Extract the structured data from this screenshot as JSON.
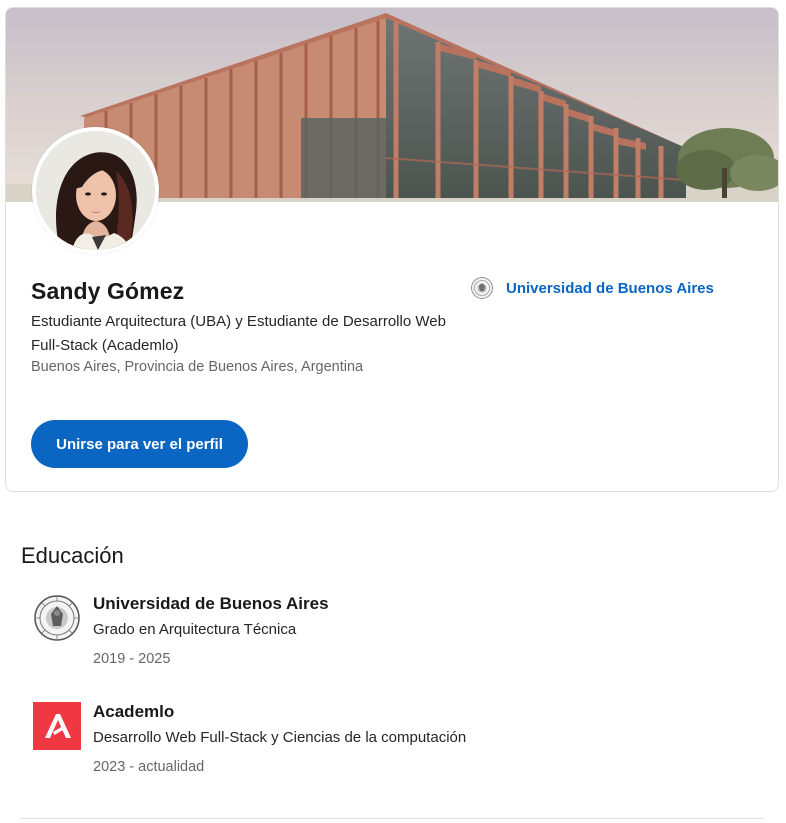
{
  "profile": {
    "name": "Sandy Gómez",
    "headline": "Estudiante Arquitectura (UBA) y Estudiante de Desarrollo Web Full-Stack (Academlo)",
    "location": "Buenos Aires, Provincia de Buenos Aires, Argentina",
    "current_school": "Universidad de Buenos Aires",
    "join_button_label": "Unirse para ver el perfil"
  },
  "education": {
    "title": "Educación",
    "items": [
      {
        "school": "Universidad de Buenos Aires",
        "degree": "Grado en Arquitectura Técnica",
        "dates": "2019 - 2025",
        "logo": "uba-seal-icon"
      },
      {
        "school": "Academlo",
        "degree": "Desarrollo Web Full-Stack y Ciencias de la computación",
        "dates": "2023 - actualidad",
        "logo": "academlo-logo-icon"
      }
    ]
  },
  "colors": {
    "primary": "#0a66c2",
    "academlo": "#ef3842",
    "text": "#191919",
    "muted": "#666666"
  }
}
